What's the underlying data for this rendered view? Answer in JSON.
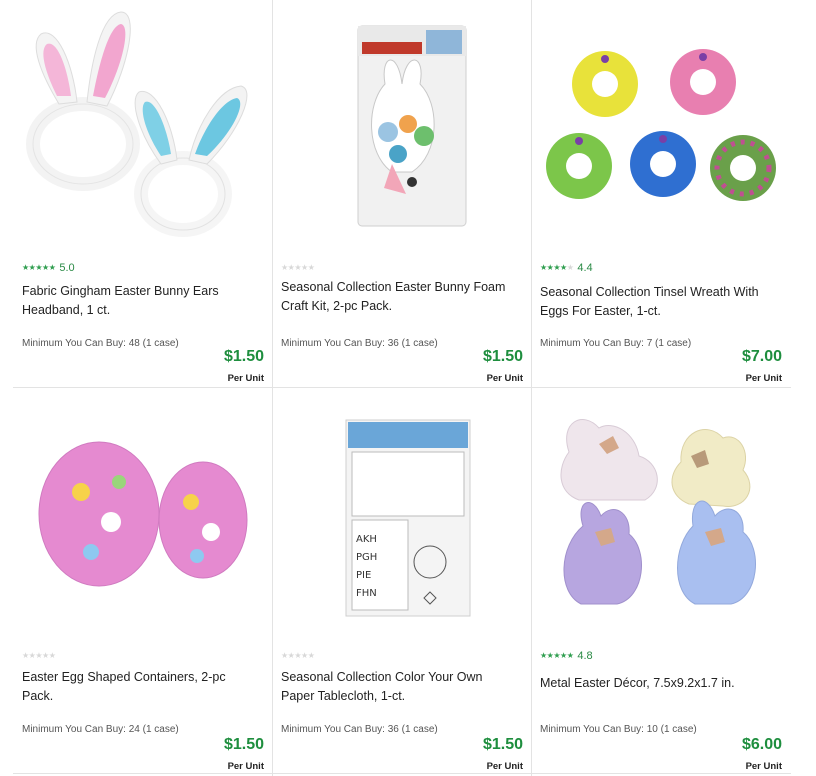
{
  "products": [
    {
      "rating_value": 5.0,
      "rating_text": "5.0",
      "title": "Fabric Gingham Easter Bunny Ears Headband, 1 ct.",
      "min_buy": "Minimum You Can Buy: 48 (1 case)",
      "price": "$1.50",
      "unit": "Per Unit",
      "image_icon": "bunny-ears-headband-icon"
    },
    {
      "rating_value": 0,
      "rating_text": "",
      "title": "Seasonal Collection Easter Bunny Foam Craft Kit, 2-pc Pack.",
      "min_buy": "Minimum You Can Buy: 36 (1 case)",
      "price": "$1.50",
      "unit": "Per Unit",
      "image_icon": "foam-craft-kit-icon"
    },
    {
      "rating_value": 4.4,
      "rating_text": "4.4",
      "title": "Seasonal Collection Tinsel Wreath With Eggs For Easter, 1-ct.",
      "min_buy": "Minimum You Can Buy: 7 (1 case)",
      "price": "$7.00",
      "unit": "Per Unit",
      "image_icon": "tinsel-wreath-icon"
    },
    {
      "rating_value": 0,
      "rating_text": "",
      "title": "Easter Egg Shaped Containers, 2-pc Pack.",
      "min_buy": "Minimum You Can Buy: 24 (1 case)",
      "price": "$1.50",
      "unit": "Per Unit",
      "image_icon": "egg-container-icon"
    },
    {
      "rating_value": 0,
      "rating_text": "",
      "title": "Seasonal Collection Color Your Own Paper Tablecloth, 1-ct.",
      "min_buy": "Minimum You Can Buy: 36 (1 case)",
      "price": "$1.50",
      "unit": "Per Unit",
      "image_icon": "tablecloth-package-icon"
    },
    {
      "rating_value": 4.8,
      "rating_text": "4.8",
      "title": "Metal Easter Décor, 7.5x9.2x1.7 in.",
      "min_buy": "Minimum You Can Buy: 10 (1 case)",
      "price": "$6.00",
      "unit": "Per Unit",
      "image_icon": "metal-bunny-chick-decor-icon"
    }
  ],
  "colors": {
    "price_green": "#1e8e3e",
    "star_green": "#2f9e4f",
    "star_empty": "#d8d8d8",
    "divider": "#e3e3e3"
  }
}
